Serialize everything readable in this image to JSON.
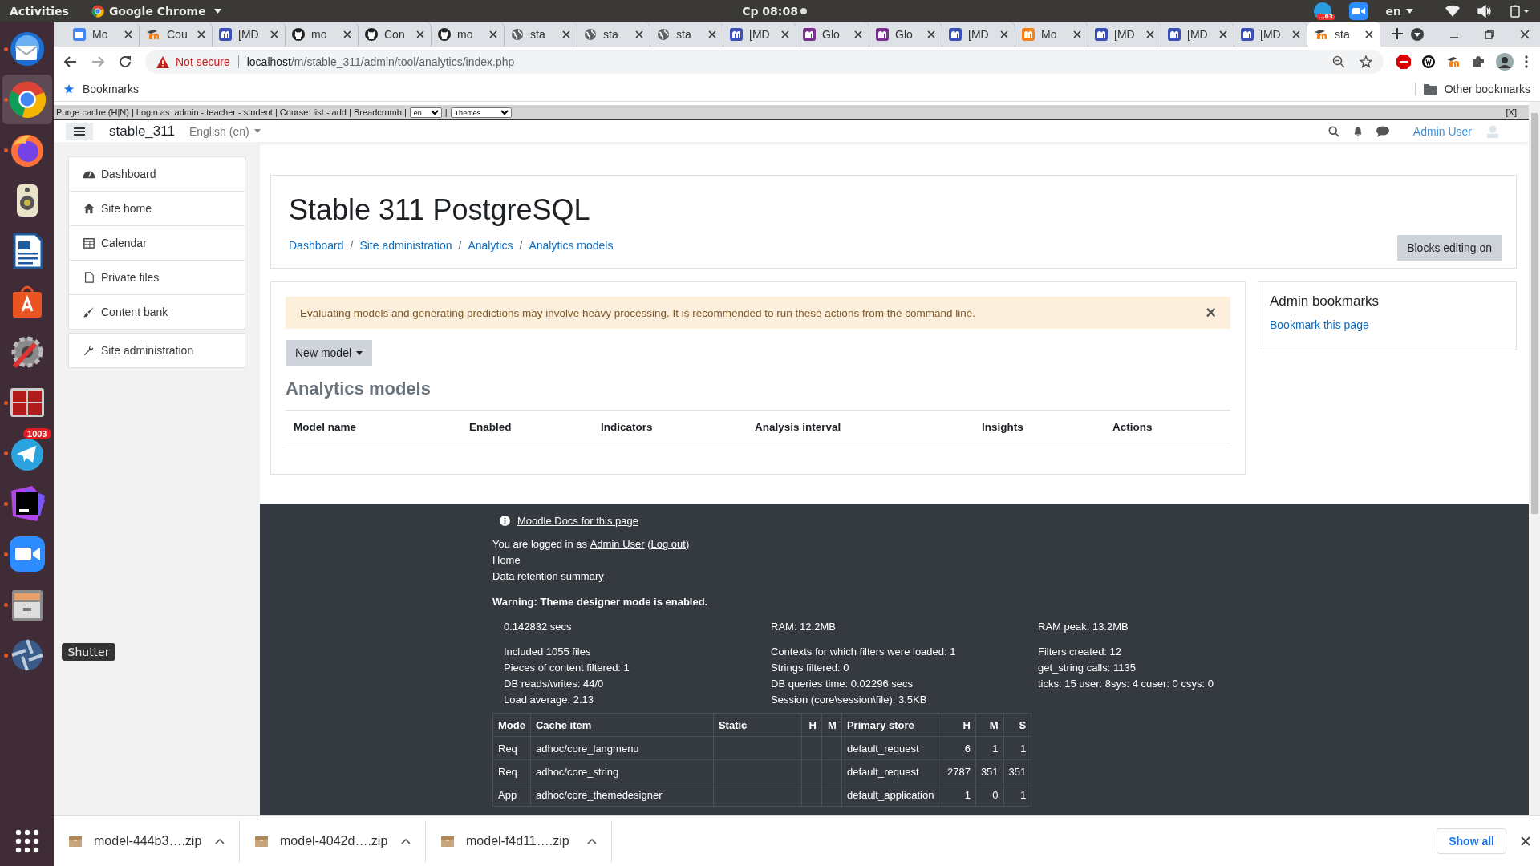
{
  "system_bar": {
    "activities": "Activities",
    "app": "Google Chrome",
    "clock": "Cp 08:08",
    "language": "en",
    "notification_badge": "...03"
  },
  "dock": {
    "items": [
      {
        "kind": "mail",
        "running": true,
        "selected": false
      },
      {
        "kind": "chrome",
        "running": true,
        "selected": true
      },
      {
        "kind": "firefox",
        "running": true,
        "selected": false
      },
      {
        "kind": "speaker",
        "running": false,
        "selected": false
      },
      {
        "kind": "writer",
        "running": false,
        "selected": false
      },
      {
        "kind": "store",
        "running": false,
        "selected": false
      },
      {
        "kind": "settings",
        "running": false,
        "selected": false
      },
      {
        "kind": "terminal",
        "running": true,
        "selected": false
      },
      {
        "kind": "telegram",
        "running": true,
        "selected": false,
        "badge": "1003"
      },
      {
        "kind": "phpstorm",
        "running": true,
        "selected": false
      },
      {
        "kind": "zoom",
        "running": true,
        "selected": false
      },
      {
        "kind": "files",
        "running": true,
        "selected": false
      },
      {
        "kind": "shutter",
        "running": true,
        "selected": false,
        "tooltip": "Shutter"
      }
    ]
  },
  "browser": {
    "tabs": [
      {
        "label": "Mo",
        "kind": "calendar",
        "selected": false
      },
      {
        "label": "Cou",
        "kind": "moodle",
        "selected": false
      },
      {
        "label": "[MD",
        "kind": "tracker",
        "selected": false
      },
      {
        "label": "mo",
        "kind": "github",
        "selected": false
      },
      {
        "label": "Con",
        "kind": "github",
        "selected": false
      },
      {
        "label": "mo",
        "kind": "github",
        "selected": false
      },
      {
        "label": "sta",
        "kind": "globe",
        "selected": false
      },
      {
        "label": "sta",
        "kind": "globe",
        "selected": false
      },
      {
        "label": "sta",
        "kind": "globe",
        "selected": false
      },
      {
        "label": "[MD",
        "kind": "tracker",
        "selected": false
      },
      {
        "label": "Glo",
        "kind": "tracker-purple",
        "selected": false
      },
      {
        "label": "Glo",
        "kind": "tracker-purple",
        "selected": false
      },
      {
        "label": "[MD",
        "kind": "tracker",
        "selected": false
      },
      {
        "label": "Mo",
        "kind": "moodle-box",
        "selected": false
      },
      {
        "label": "[MD",
        "kind": "tracker",
        "selected": false
      },
      {
        "label": "[MD",
        "kind": "tracker",
        "selected": false
      },
      {
        "label": "[MD",
        "kind": "tracker",
        "selected": false
      },
      {
        "label": "sta",
        "kind": "moodle",
        "selected": true
      }
    ],
    "security": "Not secure",
    "url_host": "localhost",
    "url_path": "/m/stable_311/admin/tool/analytics/index.php",
    "bookmarks": "Bookmarks",
    "other_bookmarks": "Other bookmarks"
  },
  "dev_bar": {
    "text": "Purge cache (H|N) | Login as: admin - teacher - student | Course: list - add | Breadcrumb |",
    "language_select": "en",
    "separator": "|",
    "theme_select": "Themes",
    "close": "[X]"
  },
  "navbar": {
    "site_name": "stable_311",
    "language": "English (en)",
    "user": "Admin User"
  },
  "nav_drawer": {
    "groups": [
      [
        {
          "label": "Dashboard",
          "kind": "dashboard"
        },
        {
          "label": "Site home",
          "kind": "home"
        },
        {
          "label": "Calendar",
          "kind": "calendar"
        },
        {
          "label": "Private files",
          "kind": "file"
        },
        {
          "label": "Content bank",
          "kind": "brush"
        }
      ],
      [
        {
          "label": "Site administration",
          "kind": "wrench"
        }
      ]
    ]
  },
  "header": {
    "title": "Stable 311 PostgreSQL",
    "breadcrumb": [
      "Dashboard",
      "Site administration",
      "Analytics",
      "Analytics models"
    ],
    "separator": "/",
    "button": "Blocks editing on"
  },
  "alert": {
    "text": "Evaluating models and generating predictions may involve heavy processing. It is recommended to run these actions from the command line.",
    "close": "×"
  },
  "new_model_button": "New model",
  "heading": "Analytics models",
  "models_table": {
    "columns": [
      "Model name",
      "Enabled",
      "Indicators",
      "Analysis interval",
      "Insights",
      "Actions"
    ]
  },
  "admin_bookmarks": {
    "title": "Admin bookmarks",
    "link": "Bookmark this page"
  },
  "footer": {
    "docs_link": "Moodle Docs for this page",
    "login": {
      "prefix": "You are logged in as",
      "user_link": "Admin User",
      "open_paren": "(",
      "logout_link": "Log out",
      "close_paren": ")"
    },
    "links": [
      "Home",
      "Data retention summary"
    ],
    "warning": "Warning: Theme designer mode is enabled.",
    "perf_top": [
      "0.142832 secs",
      "RAM: 12.2MB",
      "RAM peak: 13.2MB"
    ],
    "perf_columns": [
      [
        "Included 1055 files",
        "Pieces of content filtered: 1",
        "DB reads/writes: 44/0",
        "Load average: 2.13"
      ],
      [
        "Contexts for which filters were loaded: 1",
        "Strings filtered: 0",
        "DB queries time: 0.02296 secs",
        "Session (core\\session\\file): 3.5KB"
      ],
      [
        "Filters created: 12",
        "get_string calls: 1135",
        "ticks: 15 user: 8sys: 4 cuser: 0 csys: 0"
      ]
    ],
    "cache_table": {
      "columns": [
        "Mode",
        "Cache item",
        "Static",
        "H",
        "M",
        "Primary store",
        "H",
        "M",
        "S"
      ],
      "rows": [
        [
          "Req",
          "adhoc/core_langmenu",
          "",
          "",
          "",
          "default_request",
          "6",
          "1",
          "1"
        ],
        [
          "Req",
          "adhoc/core_string",
          "",
          "",
          "",
          "default_request",
          "2787",
          "351",
          "351"
        ],
        [
          "App",
          "adhoc/core_themedesigner",
          "",
          "",
          "",
          "default_application",
          "1",
          "0",
          "1"
        ]
      ]
    }
  },
  "downloads": {
    "items": [
      "model-444b3….zip",
      "model-4042d….zip",
      "model-f4d11….zip"
    ],
    "show_all": "Show all"
  }
}
